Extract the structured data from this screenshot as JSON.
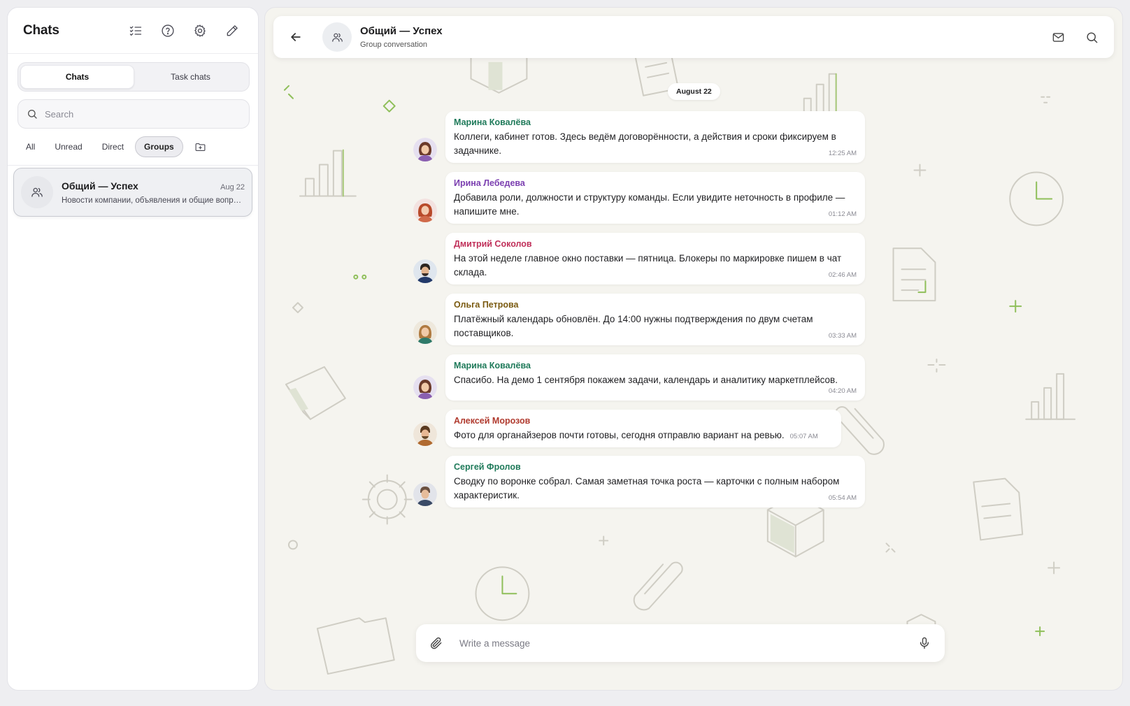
{
  "sidebar": {
    "title": "Chats",
    "header_icons": [
      "checklist-icon",
      "help-circle-icon",
      "gear-icon",
      "pencil-icon"
    ],
    "tabs": [
      {
        "label": "Chats",
        "active": true
      },
      {
        "label": "Task chats",
        "active": false
      }
    ],
    "search": {
      "placeholder": "Search",
      "value": ""
    },
    "filters": [
      {
        "label": "All",
        "active": false
      },
      {
        "label": "Unread",
        "active": false
      },
      {
        "label": "Direct",
        "active": false
      },
      {
        "label": "Groups",
        "active": true
      }
    ],
    "chats": [
      {
        "name": "Общий — Успех",
        "date": "Aug 22",
        "preview": "Новости компании, объявления и общие вопросы",
        "selected": true
      }
    ]
  },
  "conversation": {
    "title": "Общий — Успех",
    "subtitle": "Group conversation",
    "date_separator": "August 22",
    "messages": [
      {
        "author": "Марина Ковалёва",
        "author_color": "#1f7a5a",
        "text": "Коллеги, кабинет готов. Здесь ведём договорённости, а действия и сроки фиксируем в задачнике.",
        "time": "12:25 AM"
      },
      {
        "author": "Ирина Лебедева",
        "author_color": "#7b3fb0",
        "text": "Добавила роли, должности и структуру команды. Если увидите неточность в профиле — напишите мне.",
        "time": "01:12 AM"
      },
      {
        "author": "Дмитрий Соколов",
        "author_color": "#c0305a",
        "text": "На этой неделе главное окно поставки — пятница. Блокеры по маркировке пишем в чат склада.",
        "time": "02:46 AM"
      },
      {
        "author": "Ольга Петрова",
        "author_color": "#7a5a10",
        "text": "Платёжный календарь обновлён. До 14:00 нужны подтверждения по двум счетам поставщиков.",
        "time": "03:33 AM"
      },
      {
        "author": "Марина Ковалёва",
        "author_color": "#1f7a5a",
        "text": "Спасибо. На демо 1 сентября покажем задачи, календарь и аналитику маркетплейсов.",
        "time": "04:20 AM"
      },
      {
        "author": "Алексей Морозов",
        "author_color": "#b03a2e",
        "text": "Фото для органайзеров почти готовы, сегодня отправлю вариант на ревью.",
        "time": "05:07 AM"
      },
      {
        "author": "Сергей Фролов",
        "author_color": "#1f7a5a",
        "text": "Сводку по воронке собрал. Самая заметная точка роста — карточки с полным набором характеристик.",
        "time": "05:54 AM"
      }
    ],
    "composer": {
      "placeholder": "Write a message",
      "value": ""
    }
  },
  "colors": {
    "accent_green": "#1f7a5a",
    "pattern_stroke": "#cfcdc4",
    "pattern_accent": "#8fbf5a",
    "background_main": "#f5f4ef"
  }
}
